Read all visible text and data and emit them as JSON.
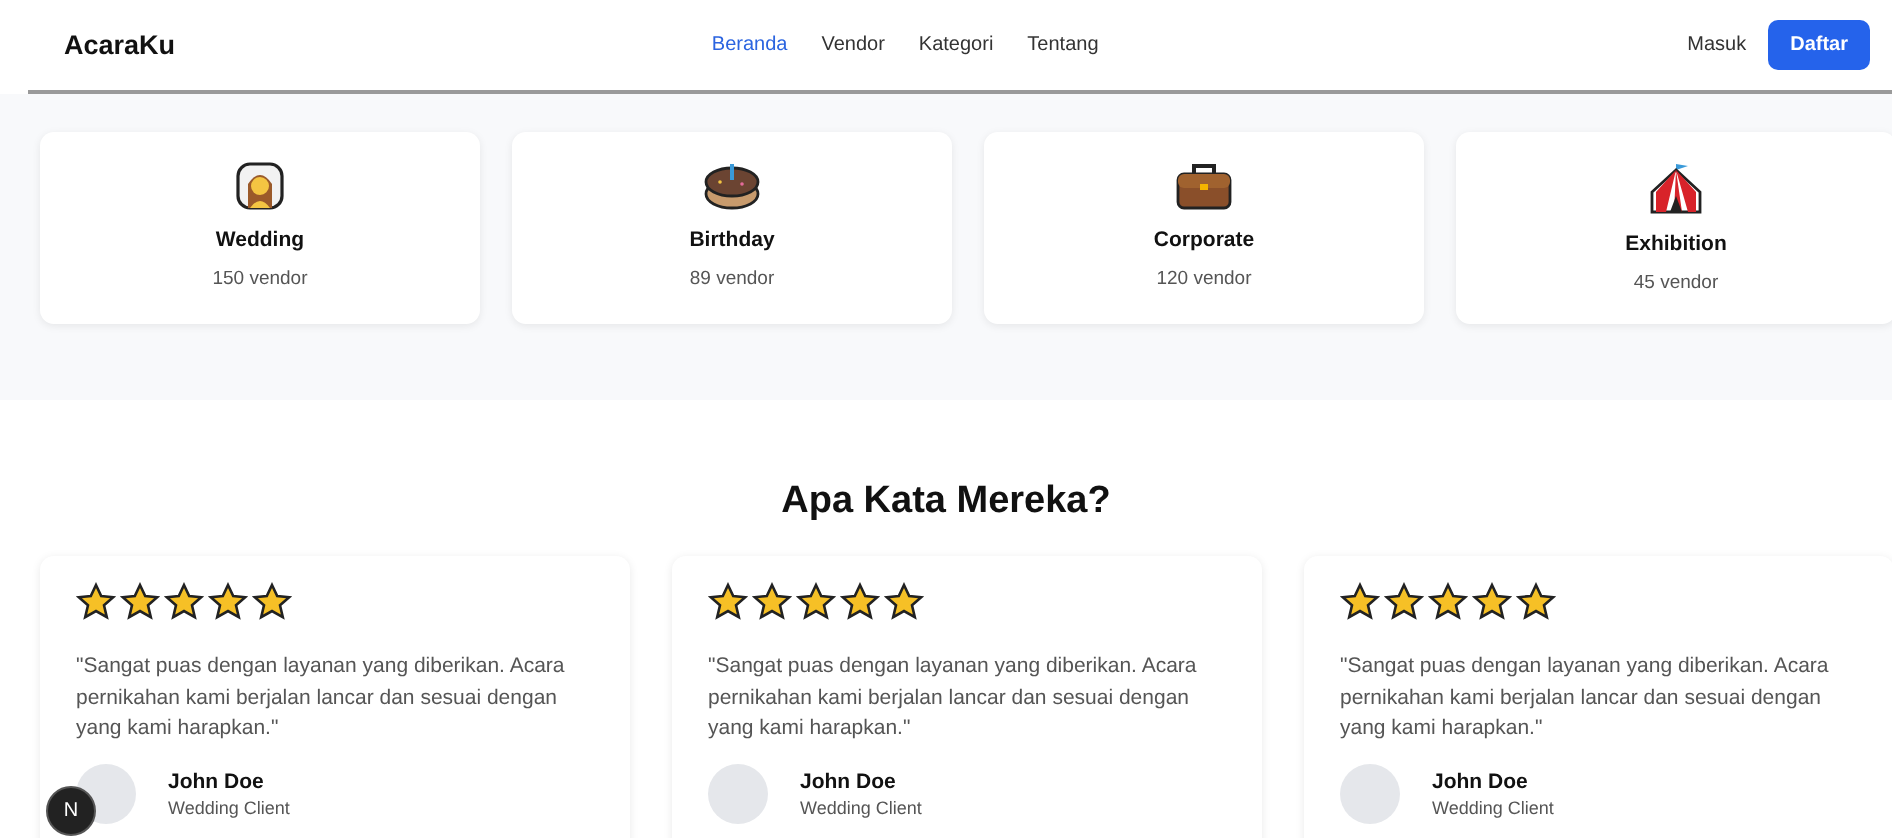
{
  "navbar": {
    "logo": "AcaraKu",
    "links": [
      {
        "label": "Beranda",
        "selected": true
      },
      {
        "label": "Vendor",
        "selected": false
      },
      {
        "label": "Kategori",
        "selected": false
      },
      {
        "label": "Tentang",
        "selected": false
      }
    ],
    "login": "Masuk",
    "signup": "Daftar"
  },
  "categories": [
    {
      "kind": "bride",
      "name": "Wedding",
      "count": "150 vendor"
    },
    {
      "kind": "cake",
      "name": "Birthday",
      "count": "89 vendor"
    },
    {
      "kind": "briefcase",
      "name": "Corporate",
      "count": "120 vendor"
    },
    {
      "kind": "tent",
      "name": "Exhibition",
      "count": "45 vendor"
    }
  ],
  "testimonials": {
    "title": "Apa Kata Mereka?",
    "items": [
      {
        "stars": 5,
        "quote": "\"Sangat puas dengan layanan yang diberikan. Acara pernikahan kami berjalan lancar dan sesuai dengan yang kami harapkan.\"",
        "name": "John Doe",
        "role": "Wedding Client"
      },
      {
        "stars": 5,
        "quote": "\"Sangat puas dengan layanan yang diberikan. Acara pernikahan kami berjalan lancar dan sesuai dengan yang kami harapkan.\"",
        "name": "John Doe",
        "role": "Wedding Client"
      },
      {
        "stars": 5,
        "quote": "\"Sangat puas dengan layanan yang diberikan. Acara pernikahan kami berjalan lancar dan sesuai dengan yang kami harapkan.\"",
        "name": "John Doe",
        "role": "Wedding Client"
      }
    ]
  },
  "dev_badge": "N"
}
